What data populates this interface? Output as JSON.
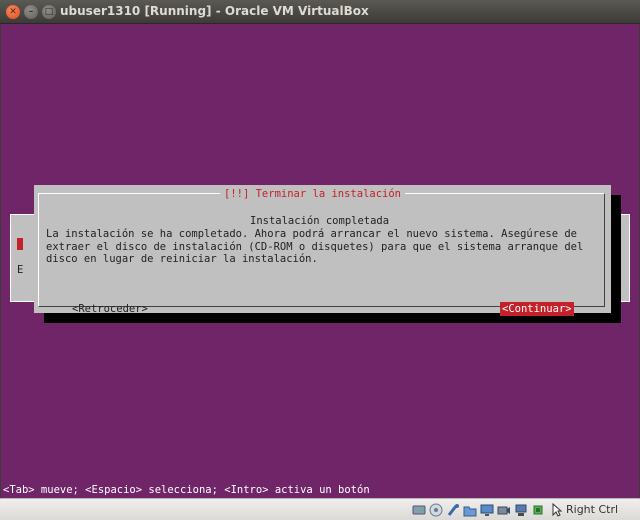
{
  "window": {
    "title": "ubuser1310 [Running] - Oracle VM VirtualBox",
    "close_glyph": "✕",
    "minimize_glyph": "–",
    "maximize_glyph": "□"
  },
  "screen": {
    "background_color": "#6f2568",
    "background_dialog": {
      "partial_text": "E"
    },
    "dialog": {
      "title": "[!!] Terminar la instalación",
      "subtitle": "Instalación completada",
      "body_lines": [
        "La instalación se ha completado. Ahora podrá arrancar el nuevo sistema. Asegúrese de",
        "extraer el disco de instalación (CD-ROM o disquetes) para que el sistema arranque del",
        "disco en lugar de reiniciar la instalación."
      ],
      "back_button": "<Retroceder>",
      "continue_button": "<Continuar>",
      "accent_color": "#c4212a"
    },
    "help_line": "<Tab> mueve; <Espacio> selecciona; <Intro> activa un botón"
  },
  "statusbar": {
    "icons": [
      "hard-disk-icon",
      "optical-drive-icon",
      "usb-icon",
      "shared-folders-icon",
      "display-icon",
      "video-capture-icon",
      "network-icon",
      "cpu-icon",
      "mouse-integration-icon"
    ],
    "host_key": "Right Ctrl"
  }
}
